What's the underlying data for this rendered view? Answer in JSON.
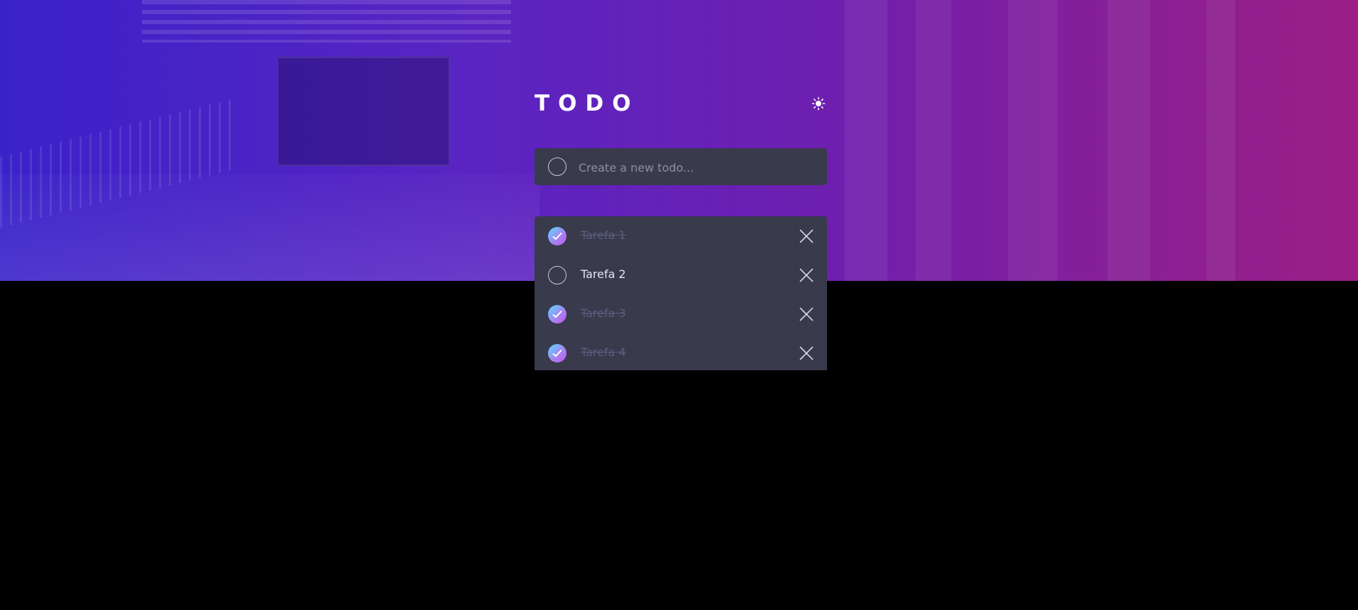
{
  "app": {
    "title": "TODO",
    "theme_toggle_icon": "sun-icon"
  },
  "new_todo": {
    "placeholder": "Create a new todo..."
  },
  "todos": [
    {
      "label": "Tarefa 1",
      "completed": true
    },
    {
      "label": "Tarefa 2",
      "completed": false
    },
    {
      "label": "Tarefa 3",
      "completed": true
    },
    {
      "label": "Tarefa 4",
      "completed": true
    }
  ],
  "colors": {
    "hero_gradient_start": "#3a22c9",
    "hero_gradient_end": "#9a1f86",
    "card_bg": "#393a4c",
    "page_bg": "#000000",
    "check_gradient_start": "#57ddff",
    "check_gradient_end": "#c058f3",
    "completed_text": "#5b5e7e",
    "active_text": "#e4e5f1"
  }
}
